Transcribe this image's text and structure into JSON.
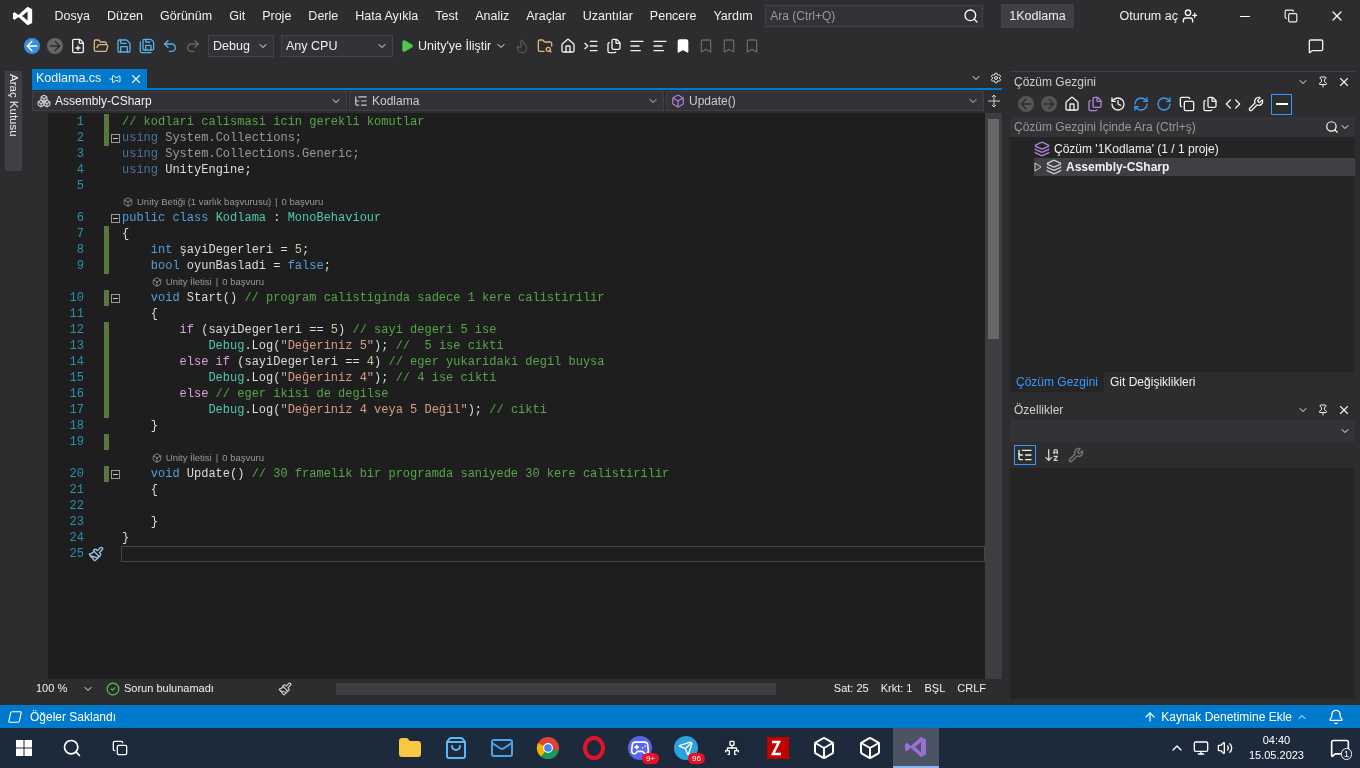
{
  "menu": {
    "items": [
      "Dosya",
      "Düzen",
      "Görünüm",
      "Git",
      "Proje",
      "Derle",
      "Hata Ayıkla",
      "Test",
      "Analiz",
      "Araçlar",
      "Uzantılar",
      "Pencere",
      "Yardım"
    ],
    "search_placeholder": "Ara (Ctrl+Q)",
    "solution_name": "1Kodlama",
    "sign_in": "Oturum aç"
  },
  "toolbar": {
    "configuration": "Debug",
    "platform": "Any CPU",
    "run": "Unity'ye İliştir"
  },
  "toolbox": {
    "label": "Araç Kutusu"
  },
  "editor": {
    "tabs": [
      {
        "title": "Kodlama.cs",
        "selected": true
      }
    ],
    "navigation": [
      "Assembly-CSharp",
      "Kodlama",
      "Update()"
    ],
    "lines": [
      {
        "kind": "code",
        "number": "1",
        "changed": true,
        "fold": false,
        "tokens": [
          {
            "kind": "comment",
            "text": "// kodlari calismasi icin gerekli komutlar"
          }
        ]
      },
      {
        "kind": "code",
        "number": "2",
        "changed": true,
        "fold": true,
        "tokens": [
          {
            "kind": "dimmed",
            "text": "using"
          },
          {
            "kind": "dimplain",
            "text": " System.Collections;"
          }
        ]
      },
      {
        "kind": "code",
        "number": "3",
        "changed": false,
        "fold": false,
        "tokens": [
          {
            "kind": "dimmed",
            "text": "using"
          },
          {
            "kind": "dimplain",
            "text": " System.Collections.Generic;"
          }
        ]
      },
      {
        "kind": "code",
        "number": "4",
        "changed": false,
        "fold": false,
        "tokens": [
          {
            "kind": "dimmed",
            "text": "using"
          },
          {
            "kind": "plain",
            "text": " UnityEngine;"
          }
        ]
      },
      {
        "kind": "code",
        "number": "5",
        "changed": false,
        "fold": false
      },
      {
        "kind": "lens",
        "parts": [
          "Unity Betiği (1 varlık başvurusu)",
          "|",
          "0 başvuru"
        ]
      },
      {
        "kind": "code",
        "number": "6",
        "changed": false,
        "fold": true,
        "tokens": [
          {
            "kind": "keyword",
            "text": "public class "
          },
          {
            "kind": "type",
            "text": "Kodlama"
          },
          {
            "kind": "plain",
            "text": " : "
          },
          {
            "kind": "type",
            "text": "MonoBehaviour"
          }
        ]
      },
      {
        "kind": "code",
        "number": "7",
        "changed": true,
        "fold": false,
        "tokens": [
          {
            "kind": "plain",
            "text": "{"
          }
        ]
      },
      {
        "kind": "code",
        "number": "8",
        "changed": true,
        "fold": false,
        "tokens": [
          {
            "kind": "keyword",
            "text": "    int"
          },
          {
            "kind": "plain",
            "text": " şayiDegerleri = "
          },
          {
            "kind": "number",
            "text": "5"
          },
          {
            "kind": "plain",
            "text": ";"
          }
        ]
      },
      {
        "kind": "code",
        "number": "9",
        "changed": true,
        "fold": false,
        "tokens": [
          {
            "kind": "keyword",
            "text": "    bool"
          },
          {
            "kind": "plain",
            "text": " oyunBasladi = "
          },
          {
            "kind": "keyword",
            "text": "false"
          },
          {
            "kind": "plain",
            "text": ";"
          }
        ]
      },
      {
        "kind": "lens",
        "parts": [
          "Unity İletisi",
          "|",
          "0 başvuru"
        ]
      },
      {
        "kind": "code",
        "number": "10",
        "changed": true,
        "fold": true,
        "tokens": [
          {
            "kind": "keyword",
            "text": "    void"
          },
          {
            "kind": "plain",
            "text": " Start() "
          },
          {
            "kind": "comment",
            "text": "// program calistiginda sadece 1 kere calistirilir"
          }
        ]
      },
      {
        "kind": "code",
        "number": "11",
        "changed": false,
        "fold": false,
        "tokens": [
          {
            "kind": "plain",
            "text": "    {"
          }
        ]
      },
      {
        "kind": "code",
        "number": "12",
        "changed": true,
        "fold": false,
        "tokens": [
          {
            "kind": "control",
            "text": "        if"
          },
          {
            "kind": "plain",
            "text": " (sayiDegerleri == "
          },
          {
            "kind": "number",
            "text": "5"
          },
          {
            "kind": "plain",
            "text": ") "
          },
          {
            "kind": "comment",
            "text": "// sayi degeri 5 ise"
          }
        ]
      },
      {
        "kind": "code",
        "number": "13",
        "changed": true,
        "fold": false,
        "tokens": [
          {
            "kind": "type",
            "text": "            Debug"
          },
          {
            "kind": "plain",
            "text": ".Log("
          },
          {
            "kind": "string",
            "text": "\"Değeriniz 5\""
          },
          {
            "kind": "plain",
            "text": "); "
          },
          {
            "kind": "comment",
            "text": "//  5 ise cikti"
          }
        ]
      },
      {
        "kind": "code",
        "number": "14",
        "changed": true,
        "fold": false,
        "tokens": [
          {
            "kind": "control",
            "text": "        else if"
          },
          {
            "kind": "plain",
            "text": " (sayiDegerleri == "
          },
          {
            "kind": "number",
            "text": "4"
          },
          {
            "kind": "plain",
            "text": ") "
          },
          {
            "kind": "comment",
            "text": "// eger yukaridaki degil buysa"
          }
        ]
      },
      {
        "kind": "code",
        "number": "15",
        "changed": true,
        "fold": false,
        "tokens": [
          {
            "kind": "type",
            "text": "            Debug"
          },
          {
            "kind": "plain",
            "text": ".Log("
          },
          {
            "kind": "string",
            "text": "\"Değeriniz 4\""
          },
          {
            "kind": "plain",
            "text": "); "
          },
          {
            "kind": "comment",
            "text": "// 4 ise cikti"
          }
        ]
      },
      {
        "kind": "code",
        "number": "16",
        "changed": true,
        "fold": false,
        "tokens": [
          {
            "kind": "control",
            "text": "        else"
          },
          {
            "kind": "comment",
            "text": " // eger ikisi de degilse"
          }
        ]
      },
      {
        "kind": "code",
        "number": "17",
        "changed": true,
        "fold": false,
        "tokens": [
          {
            "kind": "type",
            "text": "            Debug"
          },
          {
            "kind": "plain",
            "text": ".Log("
          },
          {
            "kind": "string",
            "text": "\"Değeriniz 4 veya 5 Değil\""
          },
          {
            "kind": "plain",
            "text": "); "
          },
          {
            "kind": "comment",
            "text": "// cikti"
          }
        ]
      },
      {
        "kind": "code",
        "number": "18",
        "changed": false,
        "fold": false,
        "tokens": [
          {
            "kind": "plain",
            "text": "    }"
          }
        ]
      },
      {
        "kind": "code",
        "number": "19",
        "changed": true,
        "fold": false
      },
      {
        "kind": "lens",
        "parts": [
          "Unity İletisi",
          "|",
          "0 başvuru"
        ]
      },
      {
        "kind": "code",
        "number": "20",
        "changed": true,
        "fold": true,
        "tokens": [
          {
            "kind": "keyword",
            "text": "    void"
          },
          {
            "kind": "plain",
            "text": " Update() "
          },
          {
            "kind": "comment",
            "text": "// 30 framelik bir programda saniyede 30 kere calistirilir"
          }
        ]
      },
      {
        "kind": "code",
        "number": "21",
        "changed": false,
        "fold": false,
        "tokens": [
          {
            "kind": "plain",
            "text": "    {"
          }
        ]
      },
      {
        "kind": "code",
        "number": "22",
        "changed": false,
        "fold": false
      },
      {
        "kind": "code",
        "number": "23",
        "changed": false,
        "fold": false,
        "tokens": [
          {
            "kind": "plain",
            "text": "    }"
          }
        ]
      },
      {
        "kind": "code",
        "number": "24",
        "changed": false,
        "fold": false,
        "tokens": [
          {
            "kind": "plain",
            "text": "}"
          }
        ]
      },
      {
        "kind": "code",
        "number": "25",
        "changed": false,
        "fold": false,
        "current": true
      }
    ],
    "status": {
      "zoom": "100 %",
      "issues": "Sorun bulunamadı",
      "line": "Sat: 25",
      "column": "Krkt: 1",
      "mode": "BŞL",
      "eol": "CRLF"
    }
  },
  "solution_explorer": {
    "title": "Çözüm Gezgini",
    "search_placeholder": "Çözüm Gezgini İçinde Ara (Ctrl+ş)",
    "tree": [
      {
        "label": "Çözüm '1Kodlama' (1 / 1 proje)",
        "selected": false,
        "expanded": true,
        "children": [
          {
            "label": "Assembly-CSharp",
            "selected": true,
            "expanded": false
          }
        ]
      }
    ],
    "tabs": [
      {
        "label": "Çözüm Gezgini",
        "selected": true
      },
      {
        "label": "Git Değişiklikleri",
        "selected": false
      }
    ]
  },
  "properties": {
    "title": "Özellikler"
  },
  "status_bar": {
    "left": "Öğeler Saklandı",
    "right": "Kaynak Denetimine Ekle"
  },
  "taskbar": {
    "apps": [
      {
        "kind": "folder",
        "active": false
      },
      {
        "kind": "store",
        "active": false
      },
      {
        "kind": "mail",
        "active": false
      },
      {
        "kind": "chrome",
        "active": false
      },
      {
        "kind": "opera",
        "active": false
      },
      {
        "kind": "discord",
        "active": false,
        "badge": "9+"
      },
      {
        "kind": "telegram",
        "active": false,
        "badge": "96"
      },
      {
        "kind": "steam",
        "active": false
      },
      {
        "kind": "filezilla",
        "active": false
      },
      {
        "kind": "unity",
        "active": false
      },
      {
        "kind": "unity",
        "active": false
      },
      {
        "kind": "vs",
        "active": true
      }
    ],
    "time": "04:40",
    "date": "15.05.2023",
    "notifications": "1"
  }
}
